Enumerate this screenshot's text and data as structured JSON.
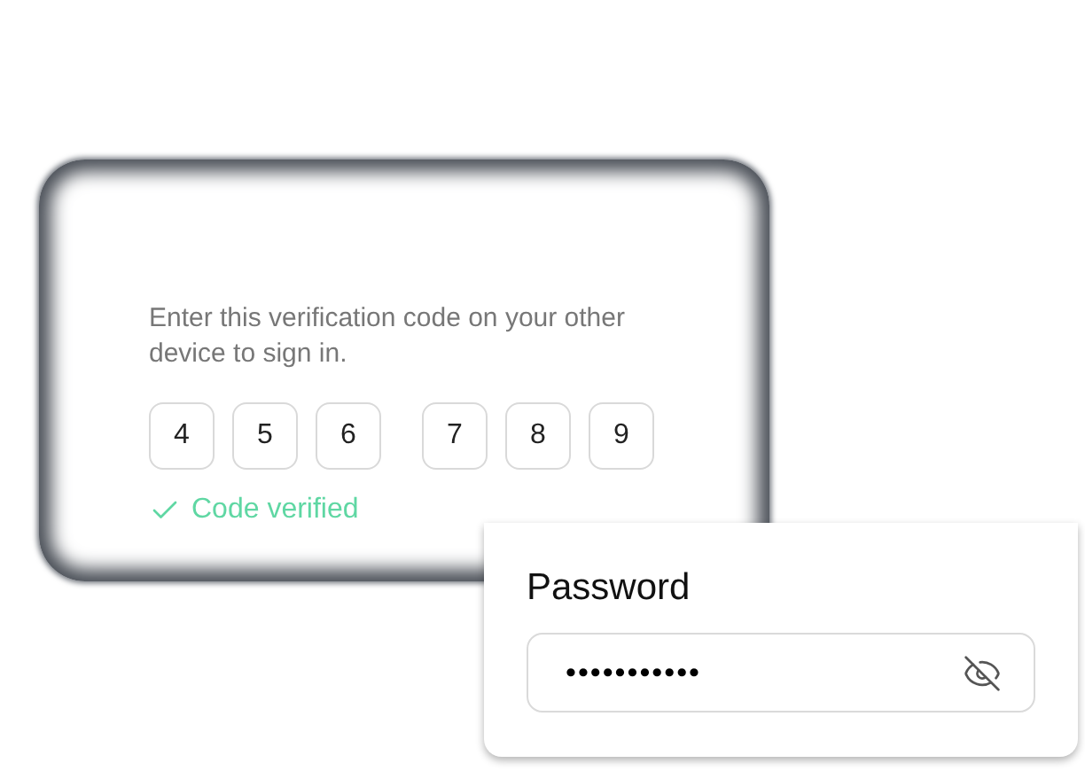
{
  "verification": {
    "instructions": "Enter this verification code on your other device to sign in.",
    "code_groups": [
      [
        "4",
        "5",
        "6"
      ],
      [
        "7",
        "8",
        "9"
      ]
    ],
    "status": {
      "text": "Code verified",
      "verified": true
    }
  },
  "password": {
    "label": "Password",
    "value": "•••••••••••",
    "visible": false
  }
}
